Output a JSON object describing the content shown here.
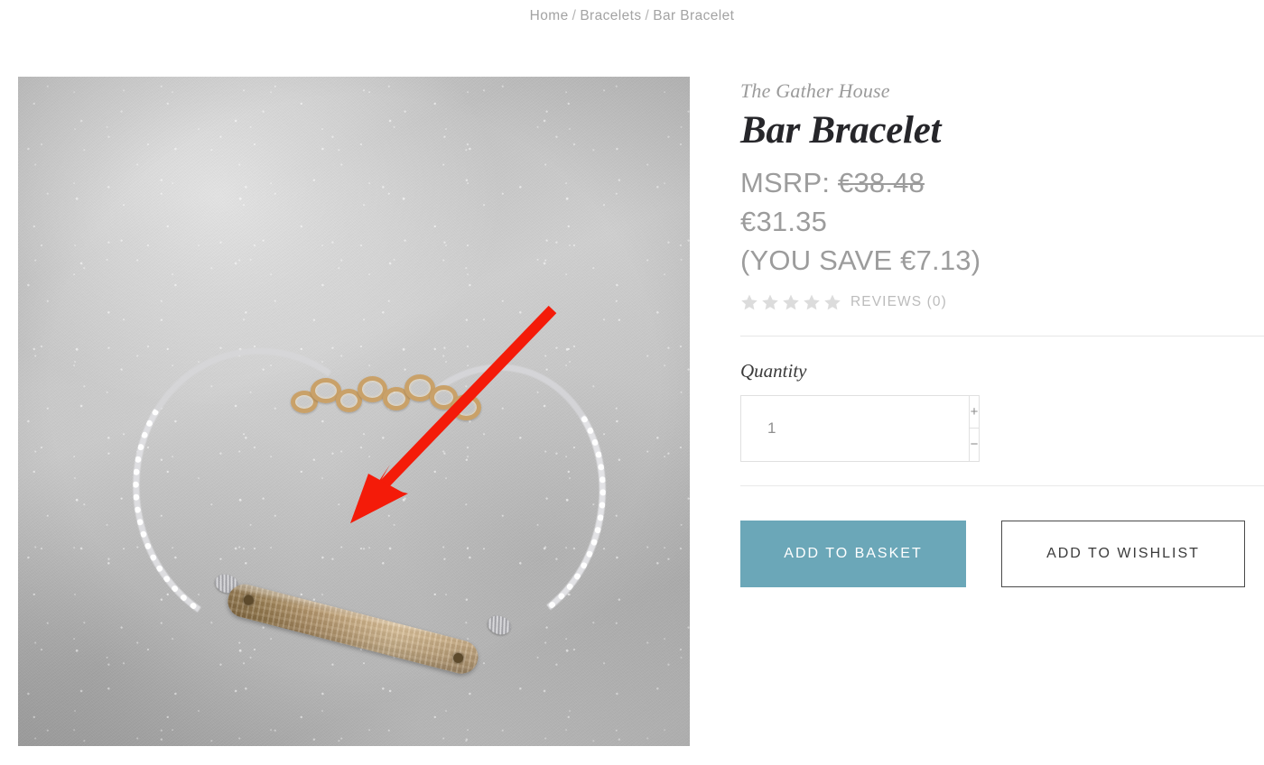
{
  "breadcrumb": {
    "items": [
      {
        "label": "Home"
      },
      {
        "label": "Bracelets"
      },
      {
        "label": "Bar Bracelet"
      }
    ],
    "separator": "/"
  },
  "product": {
    "brand": "The Gather House",
    "title": "Bar Bracelet",
    "msrp_label": "MSRP:",
    "msrp_value": "€38.48",
    "price": "€31.35",
    "savings": "(YOU SAVE €7.13)",
    "rating": {
      "stars_filled": 0,
      "stars_total": 5,
      "reviews_label": "REVIEWS (0)",
      "star_color": "#dcdcdc"
    },
    "image": {
      "alt": "Gold hammered bar bracelet with silver chain on grey marble",
      "annotation": {
        "type": "arrow",
        "color": "#f41b09",
        "points_to": "gold bar pendant"
      }
    }
  },
  "quantity": {
    "label": "Quantity",
    "value": "1",
    "placeholder": "1",
    "increase_label": "+",
    "decrease_label": "−"
  },
  "actions": {
    "add_to_basket": "ADD TO BASKET",
    "add_to_wishlist": "ADD TO WISHLIST",
    "basket_color": "#6ba7b8"
  }
}
